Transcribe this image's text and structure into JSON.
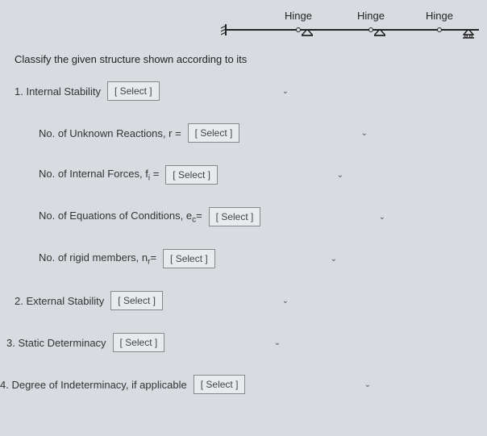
{
  "diagram": {
    "hinge_label_1": "Hinge",
    "hinge_label_2": "Hinge",
    "hinge_label_3": "Hinge"
  },
  "instruction": "Classify the given structure shown according to its",
  "q1": {
    "label": "1. Internal Stability",
    "select": "[ Select ]"
  },
  "r": {
    "label": "No. of Unknown Reactions, r =",
    "select": "[ Select ]"
  },
  "fi": {
    "label_pre": "No. of Internal Forces, f",
    "label_sub": "i",
    "label_post": " =",
    "select": "[ Select ]"
  },
  "ec": {
    "label_pre": "No. of Equations of Conditions, e",
    "label_sub": "c",
    "label_post": "=",
    "select": "[ Select ]"
  },
  "nr": {
    "label_pre": "No. of rigid members,  n",
    "label_sub": "r",
    "label_post": "=",
    "select": "[ Select ]"
  },
  "q2": {
    "label": "2. External Stability",
    "select": "[ Select ]"
  },
  "q3": {
    "label": "3. Static Determinacy",
    "select": "[ Select ]"
  },
  "q4": {
    "label": "4. Degree of Indeterminacy, if applicable",
    "select": "[ Select ]"
  }
}
